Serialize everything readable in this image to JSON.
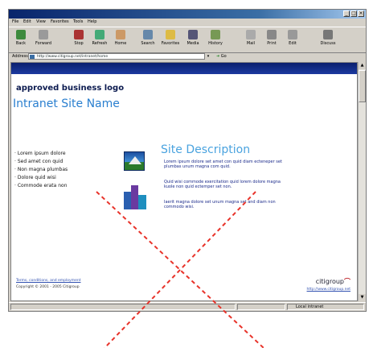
{
  "browser": {
    "menu": [
      "File",
      "Edit",
      "View",
      "Favorites",
      "Tools",
      "Help"
    ],
    "toolbar": [
      "Back",
      "Forward",
      "Stop",
      "Refresh",
      "Home",
      "Search",
      "Favorites",
      "Media",
      "History",
      "Mail",
      "Print",
      "Edit",
      "Discuss"
    ],
    "address_label": "Address",
    "address_value": "http://www.citigroup.net/intranet/home",
    "go_label": "Go",
    "status_zone": "Local intranet"
  },
  "page": {
    "logo_text": "approved business logo",
    "site_name": "Intranet Site Name",
    "nav_items": [
      "Lorem ipsum dolore",
      "Sed amet con quid",
      "Non magna plumbas",
      "Dolore quid wisi",
      "Commode erata non"
    ],
    "description_title": "Site Description",
    "paragraphs": [
      "Lorem ipsum dolore set amet con quid diam ecteneper set plumbas unum magna com quid.",
      "Quid wisi commode exercitation quid lorem dolore magna kuole non quid ectemper set non.",
      "Iaerit magna dolore set unum magna set and diam non commodo wisi."
    ],
    "footer_link": "Terms, conditions, and employment",
    "copyright": "Copyright © 2001 - 2005 Citigroup",
    "corp_logo_text": "citigroup",
    "corp_url": "http://www.citigroup.net"
  },
  "colors": {
    "banner": "#0a1f6e",
    "site_name": "#2a7fcf",
    "description_title": "#4aa3df",
    "paragraph": "#1a2a8a",
    "overlay_x": "#e8332a"
  }
}
